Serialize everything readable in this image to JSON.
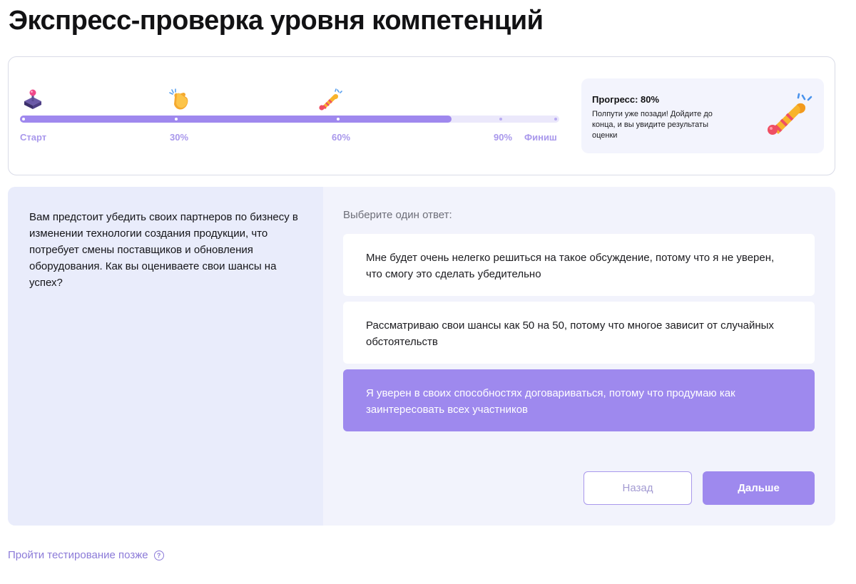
{
  "page": {
    "title": "Экспресс-проверка уровня компетенций"
  },
  "progress": {
    "value_percent": 80,
    "milestones": [
      {
        "label": "Старт",
        "icon": "joystick-icon"
      },
      {
        "label": "30%",
        "icon": "clapping-hands-icon"
      },
      {
        "label": "60%",
        "icon": "party-horn-icon"
      },
      {
        "label": "90%",
        "icon": ""
      },
      {
        "label": "Финиш",
        "icon": ""
      }
    ],
    "info_title": "Прогресс: 80%",
    "info_text": "Полпути уже позади! Дойдите до конца, и вы увидите результаты оценки",
    "info_icon": "party-horn-icon",
    "colors": {
      "fill": "#9f88ee",
      "track": "#ebe8fb",
      "label": "#a998ec"
    }
  },
  "question": {
    "text": "Вам предстоит убедить своих партнеров по бизнесу в изменении технологии создания продукции, что потребует смены поставщиков и обновления оборудования. Как вы оцениваете свои шансы на успех?"
  },
  "answers": {
    "hint": "Выберите один ответ:",
    "options": [
      {
        "text": "Мне будет очень нелегко решиться на такое обсуждение, потому что я не уверен, что смогу это сделать убедительно",
        "selected": false
      },
      {
        "text": "Рассматриваю свои шансы как 50 на 50, потому что многое зависит от случайных обстоятельств",
        "selected": false
      },
      {
        "text": "Я уверен в своих способностях договариваться, потому что продумаю как заинтересовать всех участников",
        "selected": true
      }
    ],
    "selected_color": "#9e89ee"
  },
  "buttons": {
    "back_label": "Назад",
    "next_label": "Дальше"
  },
  "footer": {
    "later_link": "Пройти тестирование позже",
    "later_icon": "help-circle-icon"
  }
}
